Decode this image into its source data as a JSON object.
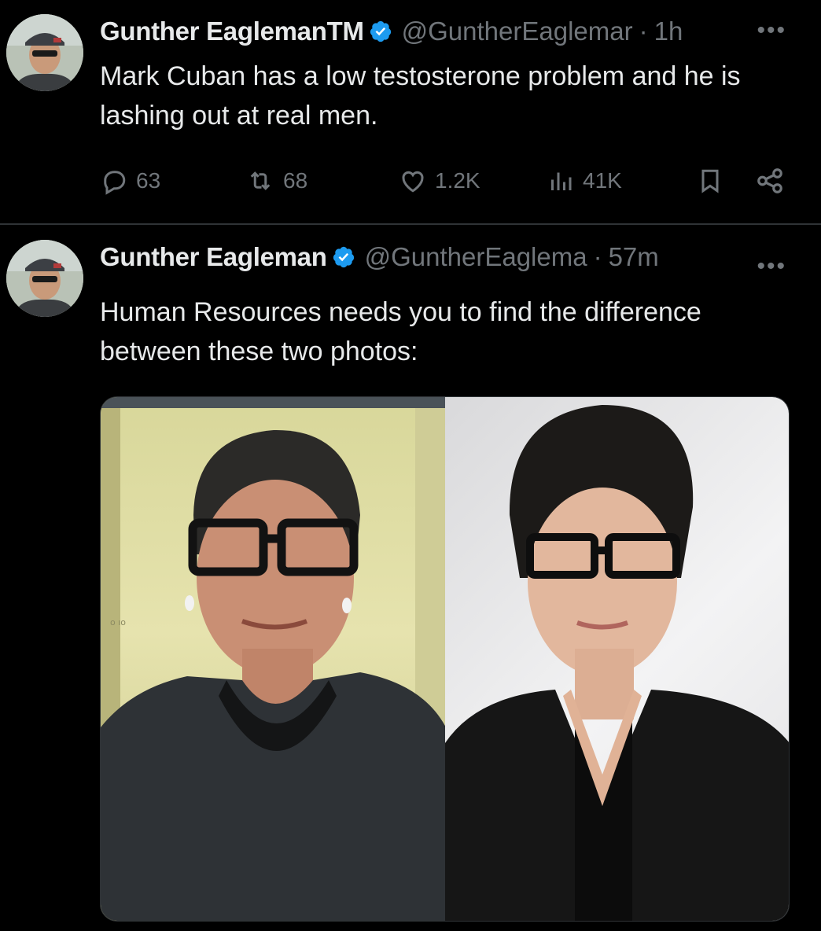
{
  "tweets": [
    {
      "author": {
        "name": "Gunther EaglemanTM",
        "handle": "@GuntherEaglemar",
        "verified": true
      },
      "time": "1h",
      "text": "Mark Cuban has a low testosterone problem and he is lashing out at real men.",
      "stats": {
        "replies": "63",
        "reposts": "68",
        "likes": "1.2K",
        "views": "41K"
      }
    },
    {
      "author": {
        "name": "Gunther Eagleman",
        "handle": "@GuntherEaglema",
        "verified": true
      },
      "time": "57m",
      "text": "Human Resources needs you to find the difference between these two photos:",
      "media": {
        "count": 2
      }
    }
  ],
  "ui": {
    "separator": "·",
    "more": "•••"
  },
  "colors": {
    "background": "#000000",
    "text": "#e7e9ea",
    "muted": "#71767b",
    "verified": "#1d9bf0",
    "divider": "#2f3336"
  },
  "icons": [
    "reply-icon",
    "repost-icon",
    "like-icon",
    "views-icon",
    "bookmark-icon",
    "share-icon",
    "verified-icon",
    "more-icon"
  ]
}
